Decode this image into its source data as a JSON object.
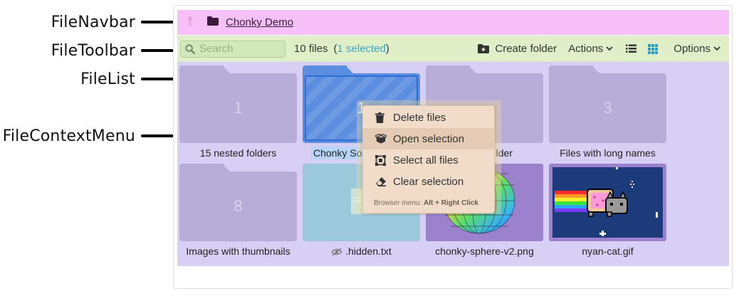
{
  "callouts": [
    {
      "label": "FileNavbar"
    },
    {
      "label": "FileToolbar"
    },
    {
      "label": "FileList"
    },
    {
      "label": "FileContextMenu"
    }
  ],
  "navbar": {
    "breadcrumb": "Chonky Demo",
    "up_icon": "arrow-up-icon",
    "folder_icon": "folder-icon"
  },
  "toolbar": {
    "search_placeholder": "Search",
    "file_count": "10 files",
    "selected_open": "(",
    "selected_text": "1 selected",
    "selected_close": ")",
    "create_folder": "Create folder",
    "actions": "Actions",
    "options": "Options"
  },
  "files": [
    {
      "name": "15 nested folders",
      "type": "folder",
      "count": "1"
    },
    {
      "name": "Chonky So",
      "type": "folder",
      "count": "1",
      "selected": true
    },
    {
      "name": "lder",
      "type": "folder",
      "count": ""
    },
    {
      "name": "Files with long names",
      "type": "folder",
      "count": "3"
    },
    {
      "name": "Images with thumbnails",
      "type": "folder",
      "count": "8"
    },
    {
      "name": ".hidden.txt",
      "type": "file",
      "hidden": true
    },
    {
      "name": "chonky-sphere-v2.png",
      "type": "image"
    },
    {
      "name": "nyan-cat.gif",
      "type": "image"
    }
  ],
  "context_menu": {
    "items": [
      {
        "label": "Delete files",
        "icon": "trash-icon"
      },
      {
        "label": "Open selection",
        "icon": "open-box-icon",
        "active": true
      },
      {
        "label": "Select all files",
        "icon": "select-all-icon"
      },
      {
        "label": "Clear selection",
        "icon": "eraser-icon"
      }
    ],
    "footer_prefix": "Browser menu: ",
    "footer_shortcut": "Alt + Right Click"
  },
  "colors": {
    "navbar": "#f8c0f8",
    "toolbar": "#dff0c8",
    "filelist": "#d8d0f4",
    "context_menu": "#f0dcc8",
    "accent": "#3aa6c8"
  }
}
